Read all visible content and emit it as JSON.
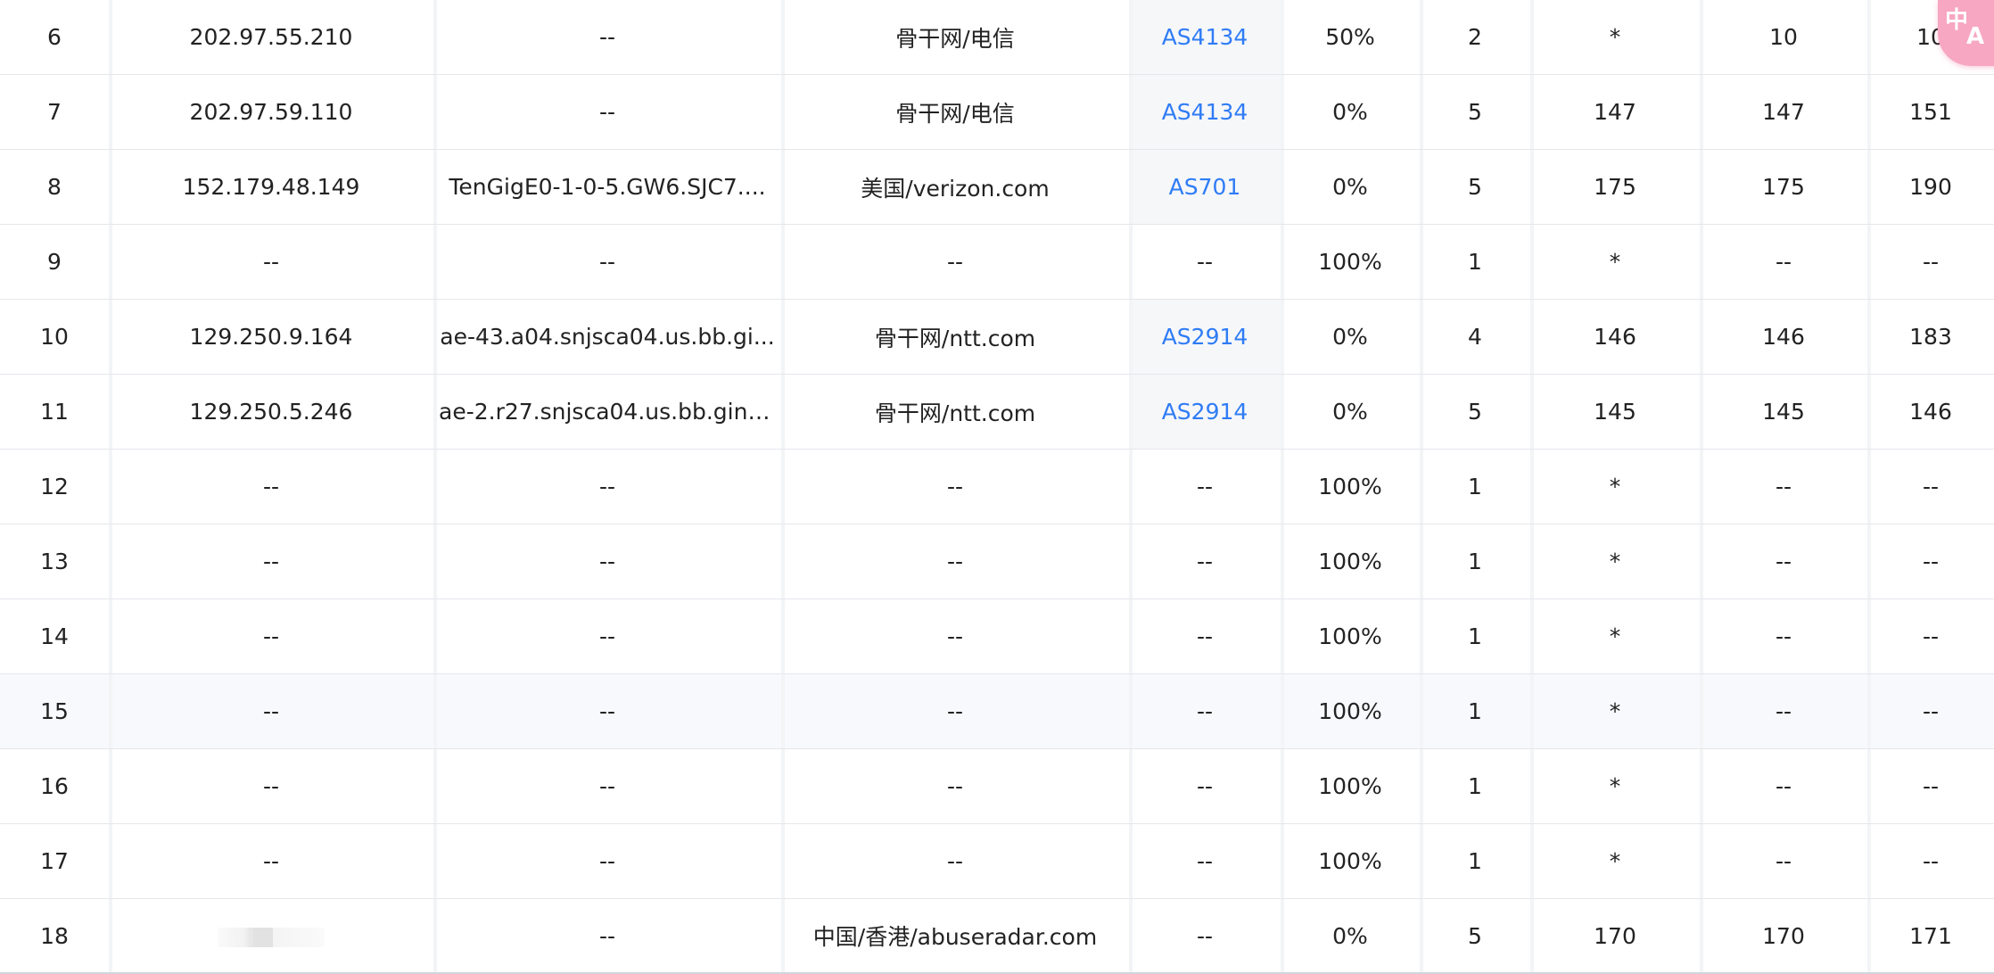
{
  "table": {
    "rows": [
      {
        "hop": "6",
        "ip": "202.97.55.210",
        "hostname": "--",
        "location": "骨干网/电信",
        "asn": "AS4134",
        "loss": "50%",
        "sent": "2",
        "last": "*",
        "best": "10",
        "worst": "10"
      },
      {
        "hop": "7",
        "ip": "202.97.59.110",
        "hostname": "--",
        "location": "骨干网/电信",
        "asn": "AS4134",
        "loss": "0%",
        "sent": "5",
        "last": "147",
        "best": "147",
        "worst": "151"
      },
      {
        "hop": "8",
        "ip": "152.179.48.149",
        "hostname": "TenGigE0-1-0-5.GW6.SJC7....",
        "location": "美国/verizon.com",
        "asn": "AS701",
        "loss": "0%",
        "sent": "5",
        "last": "175",
        "best": "175",
        "worst": "190"
      },
      {
        "hop": "9",
        "ip": "--",
        "hostname": "--",
        "location": "--",
        "asn": "--",
        "loss": "100%",
        "sent": "1",
        "last": "*",
        "best": "--",
        "worst": "--"
      },
      {
        "hop": "10",
        "ip": "129.250.9.164",
        "hostname": "ae-43.a04.snjsca04.us.bb.gi...",
        "location": "骨干网/ntt.com",
        "asn": "AS2914",
        "loss": "0%",
        "sent": "4",
        "last": "146",
        "best": "146",
        "worst": "183"
      },
      {
        "hop": "11",
        "ip": "129.250.5.246",
        "hostname": "ae-2.r27.snjsca04.us.bb.gin....",
        "location": "骨干网/ntt.com",
        "asn": "AS2914",
        "loss": "0%",
        "sent": "5",
        "last": "145",
        "best": "145",
        "worst": "146"
      },
      {
        "hop": "12",
        "ip": "--",
        "hostname": "--",
        "location": "--",
        "asn": "--",
        "loss": "100%",
        "sent": "1",
        "last": "*",
        "best": "--",
        "worst": "--"
      },
      {
        "hop": "13",
        "ip": "--",
        "hostname": "--",
        "location": "--",
        "asn": "--",
        "loss": "100%",
        "sent": "1",
        "last": "*",
        "best": "--",
        "worst": "--"
      },
      {
        "hop": "14",
        "ip": "--",
        "hostname": "--",
        "location": "--",
        "asn": "--",
        "loss": "100%",
        "sent": "1",
        "last": "*",
        "best": "--",
        "worst": "--"
      },
      {
        "hop": "15",
        "ip": "--",
        "hostname": "--",
        "location": "--",
        "asn": "--",
        "loss": "100%",
        "sent": "1",
        "last": "*",
        "best": "--",
        "worst": "--"
      },
      {
        "hop": "16",
        "ip": "--",
        "hostname": "--",
        "location": "--",
        "asn": "--",
        "loss": "100%",
        "sent": "1",
        "last": "*",
        "best": "--",
        "worst": "--"
      },
      {
        "hop": "17",
        "ip": "--",
        "hostname": "--",
        "location": "--",
        "asn": "--",
        "loss": "100%",
        "sent": "1",
        "last": "*",
        "best": "--",
        "worst": "--"
      },
      {
        "hop": "18",
        "ip": "",
        "hostname": "--",
        "location": "中国/香港/abuseradar.com",
        "asn": "--",
        "loss": "0%",
        "sent": "5",
        "last": "170",
        "best": "170",
        "worst": "171"
      }
    ]
  },
  "translate_button": {
    "glyph": "中",
    "latin": "A",
    "icon": "translate-icon",
    "color": "#f7a7c2"
  },
  "colors": {
    "link": "#2f7cf6",
    "hover_row": "#f7f9fc"
  }
}
